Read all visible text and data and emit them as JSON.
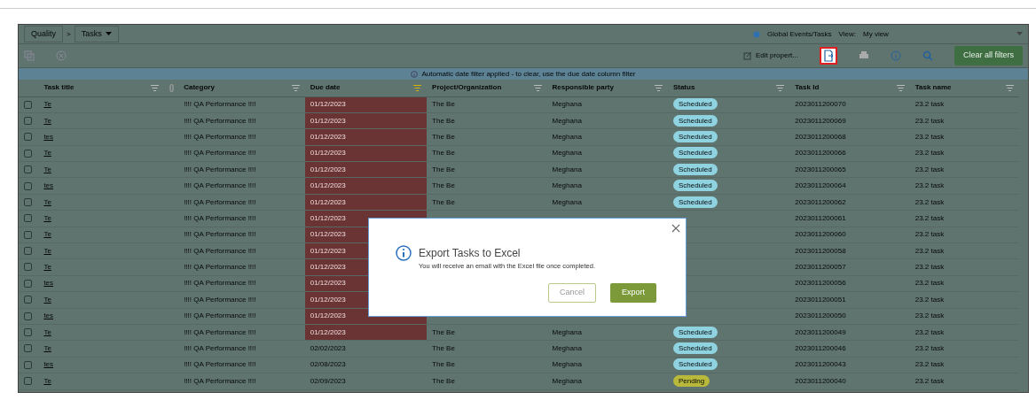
{
  "breadcrumb_separator": ">",
  "breadcrumb": [
    {
      "label": "Quality",
      "dropdown": false
    },
    {
      "label": "Tasks",
      "dropdown": true
    }
  ],
  "header_right": {
    "scope_link": "Global Events/Tasks",
    "view_label": "View:",
    "view_value": "My view"
  },
  "toolbar": {
    "edit_label": "Edit propert...",
    "clear_label": "Clear all filters",
    "export_highlighted": true
  },
  "banner": "Automatic date filter applied - to clear, use the due date column filter",
  "columns": [
    {
      "label": "Task title",
      "filtered": false
    },
    {
      "label": "Category",
      "filtered": false
    },
    {
      "label": "Due date",
      "filtered": true
    },
    {
      "label": "Project/Organization",
      "filtered": false
    },
    {
      "label": "Responsible party",
      "filtered": false
    },
    {
      "label": "Status",
      "filtered": false
    },
    {
      "label": "Task Id",
      "filtered": false
    },
    {
      "label": "Task name",
      "filtered": false
    }
  ],
  "rows": [
    {
      "checked": false,
      "title": "Te",
      "category": "!!!! QA Performance !!!!",
      "due": "01/12/2023",
      "overdue": true,
      "project": "The Be",
      "responsible": "Meghana",
      "status": {
        "label": "Scheduled",
        "color": "#8fd3e0"
      },
      "task_id": "2023011200070",
      "task_name": "23.2 task"
    },
    {
      "checked": false,
      "title": "Te",
      "category": "!!!! QA Performance !!!!",
      "due": "01/12/2023",
      "overdue": true,
      "project": "The Be",
      "responsible": "Meghana",
      "status": {
        "label": "Scheduled",
        "color": "#8fd3e0"
      },
      "task_id": "2023011200069",
      "task_name": "23.2 task"
    },
    {
      "checked": false,
      "title": "tes",
      "category": "!!!! QA Performance !!!!",
      "due": "01/12/2023",
      "overdue": true,
      "project": "The Be",
      "responsible": "Meghana",
      "status": {
        "label": "Scheduled",
        "color": "#8fd3e0"
      },
      "task_id": "2023011200068",
      "task_name": "23.2 task"
    },
    {
      "checked": false,
      "title": "Te",
      "category": "!!!! QA Performance !!!!",
      "due": "01/12/2023",
      "overdue": true,
      "project": "The Be",
      "responsible": "Meghana",
      "status": {
        "label": "Scheduled",
        "color": "#8fd3e0"
      },
      "task_id": "2023011200066",
      "task_name": "23.2 task"
    },
    {
      "checked": false,
      "title": "Te",
      "category": "!!!! QA Performance !!!!",
      "due": "01/12/2023",
      "overdue": true,
      "project": "The Be",
      "responsible": "Meghana",
      "status": {
        "label": "Scheduled",
        "color": "#8fd3e0"
      },
      "task_id": "2023011200065",
      "task_name": "23.2 task"
    },
    {
      "checked": false,
      "title": "tes",
      "category": "!!!! QA Performance !!!!",
      "due": "01/12/2023",
      "overdue": true,
      "project": "The Be",
      "responsible": "Meghana",
      "status": {
        "label": "Scheduled",
        "color": "#8fd3e0"
      },
      "task_id": "2023011200064",
      "task_name": "23.2 task"
    },
    {
      "checked": false,
      "title": "Te",
      "category": "!!!! QA Performance !!!!",
      "due": "01/12/2023",
      "overdue": true,
      "project": "The Be",
      "responsible": "Meghana",
      "status": {
        "label": "Scheduled",
        "color": "#8fd3e0"
      },
      "task_id": "2023011200062",
      "task_name": "23.2 task"
    },
    {
      "checked": false,
      "title": "Te",
      "category": "!!!! QA Performance !!!!",
      "due": "01/12/2023",
      "overdue": true,
      "task_id": "2023011200061",
      "task_name": "23.2 task"
    },
    {
      "checked": false,
      "title": "Te",
      "category": "!!!! QA Performance !!!!",
      "due": "01/12/2023",
      "overdue": true,
      "task_id": "2023011200060",
      "task_name": "23.2 task"
    },
    {
      "checked": false,
      "title": "Te",
      "category": "!!!! QA Performance !!!!",
      "due": "01/12/2023",
      "overdue": true,
      "task_id": "2023011200058",
      "task_name": "23.2 task"
    },
    {
      "checked": false,
      "title": "Te",
      "category": "!!!! QA Performance !!!!",
      "due": "01/12/2023",
      "overdue": true,
      "task_id": "2023011200057",
      "task_name": "23.2 task"
    },
    {
      "checked": false,
      "title": "tes",
      "category": "!!!! QA Performance !!!!",
      "due": "01/12/2023",
      "overdue": true,
      "task_id": "2023011200056",
      "task_name": "23.2 task"
    },
    {
      "checked": false,
      "title": "Te",
      "category": "!!!! QA Performance !!!!",
      "due": "01/12/2023",
      "overdue": true,
      "task_id": "2023011200051",
      "task_name": "23.2 task"
    },
    {
      "checked": false,
      "title": "tes",
      "category": "!!!! QA Performance !!!!",
      "due": "01/12/2023",
      "overdue": true,
      "task_id": "2023011200050",
      "task_name": "23.2 task"
    },
    {
      "checked": false,
      "title": "Te",
      "category": "!!!! QA Performance !!!!",
      "due": "01/12/2023",
      "overdue": true,
      "project": "The Be",
      "responsible": "Meghana",
      "status": {
        "label": "Scheduled",
        "color": "#8fd3e0"
      },
      "task_id": "2023011200049",
      "task_name": "23.2 task"
    },
    {
      "checked": false,
      "title": "Te",
      "category": "!!!! QA Performance !!!!",
      "due": "02/02/2023",
      "overdue": false,
      "project": "The Be",
      "responsible": "Meghana",
      "status": {
        "label": "Scheduled",
        "color": "#8fd3e0"
      },
      "task_id": "2023011200046",
      "task_name": "23.2 task"
    },
    {
      "checked": false,
      "title": "tes",
      "category": "!!!! QA Performance !!!!",
      "due": "02/08/2023",
      "overdue": false,
      "project": "The Be",
      "responsible": "Meghana",
      "status": {
        "label": "Scheduled",
        "color": "#8fd3e0"
      },
      "task_id": "2023011200043",
      "task_name": "23.2 task"
    },
    {
      "checked": false,
      "title": "Te",
      "category": "!!!! QA Performance !!!!",
      "due": "02/09/2023",
      "overdue": false,
      "project": "The Be",
      "responsible": "Meghana",
      "status": {
        "label": "Pending",
        "color": "#b8b83a"
      },
      "task_id": "2023011200040",
      "task_name": "23.2 task"
    }
  ],
  "dialog": {
    "title": "Export Tasks to Excel",
    "message": "You will receive an email with the Excel file once completed.",
    "cancel": "Cancel",
    "confirm": "Export"
  }
}
